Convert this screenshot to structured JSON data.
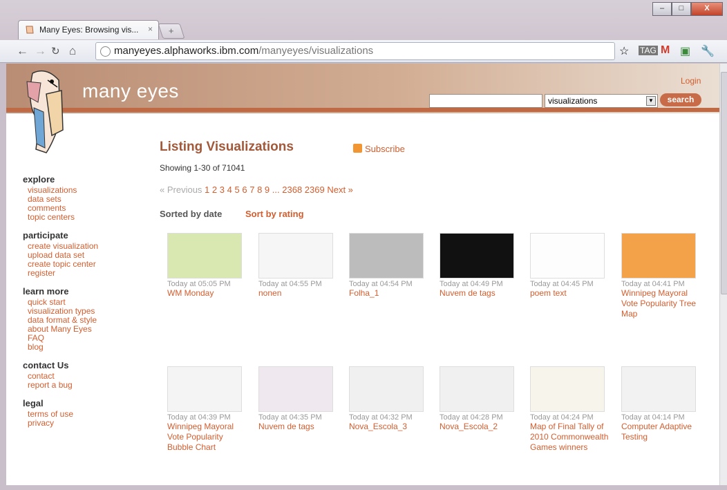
{
  "browser": {
    "tab_title": "Many Eyes: Browsing vis...",
    "tab_close": "×",
    "new_tab": "+",
    "url_host": "manyeyes.alphaworks.ibm.com",
    "url_path": "/manyeyes/visualizations",
    "win_min": "–",
    "win_max": "□",
    "win_close": "X"
  },
  "site": {
    "brand": "many eyes",
    "login": "Login",
    "search_placeholder": "",
    "search_select": "visualizations",
    "search_button": "search"
  },
  "sidebar": {
    "sections": [
      {
        "title": "explore",
        "items": [
          "visualizations",
          "data sets",
          "comments",
          "topic centers"
        ]
      },
      {
        "title": "participate",
        "items": [
          "create visualization",
          "upload data set",
          "create topic center",
          "register"
        ]
      },
      {
        "title": "learn more",
        "items": [
          "quick start",
          "visualization types",
          "data format & style",
          "about Many Eyes",
          "FAQ",
          "blog"
        ]
      },
      {
        "title": "contact Us",
        "items": [
          "contact",
          "report a bug"
        ]
      },
      {
        "title": "legal",
        "items": [
          "terms of use",
          "privacy"
        ]
      }
    ]
  },
  "main": {
    "title": "Listing Visualizations",
    "subscribe": "Subscribe",
    "showing": "Showing 1-30 of 71041",
    "pager": {
      "previous": "« Previous",
      "pages": [
        "1",
        "2",
        "3",
        "4",
        "5",
        "6",
        "7",
        "8",
        "9"
      ],
      "ellipsis": "...",
      "far_pages": [
        "2368",
        "2369"
      ],
      "next": "Next »"
    },
    "sorted_by": "Sorted by date",
    "sort_rating": "Sort by rating",
    "cards": [
      {
        "time": "Today at 05:05 PM",
        "title": "WM Monday",
        "thumb_color": "#d9e7b0"
      },
      {
        "time": "Today at 04:55 PM",
        "title": "nonen",
        "thumb_color": "#f6f6f6"
      },
      {
        "time": "Today at 04:54 PM",
        "title": "Folha_1",
        "thumb_color": "#bcbcbc"
      },
      {
        "time": "Today at 04:49 PM",
        "title": "Nuvem de tags",
        "thumb_color": "#111111"
      },
      {
        "time": "Today at 04:45 PM",
        "title": "poem text",
        "thumb_color": "#fdfdfd"
      },
      {
        "time": "Today at 04:41 PM",
        "title": "Winnipeg Mayoral Vote Popularity Tree Map",
        "thumb_color": "#f4a24a"
      },
      {
        "time": "Today at 04:39 PM",
        "title": "Winnipeg Mayoral Vote Popularity Bubble Chart",
        "thumb_color": "#f4f4f4"
      },
      {
        "time": "Today at 04:35 PM",
        "title": "Nuvem de tags",
        "thumb_color": "#efe8ee"
      },
      {
        "time": "Today at 04:32 PM",
        "title": "Nova_Escola_3",
        "thumb_color": "#f0f0f0"
      },
      {
        "time": "Today at 04:28 PM",
        "title": "Nova_Escola_2",
        "thumb_color": "#f0f0f0"
      },
      {
        "time": "Today at 04:24 PM",
        "title": "Map of Final Tally of 2010 Commonwealth Games winners",
        "thumb_color": "#f7f4ec"
      },
      {
        "time": "Today at 04:14 PM",
        "title": "Computer Adaptive Testing",
        "thumb_color": "#f2f2f2"
      }
    ]
  }
}
